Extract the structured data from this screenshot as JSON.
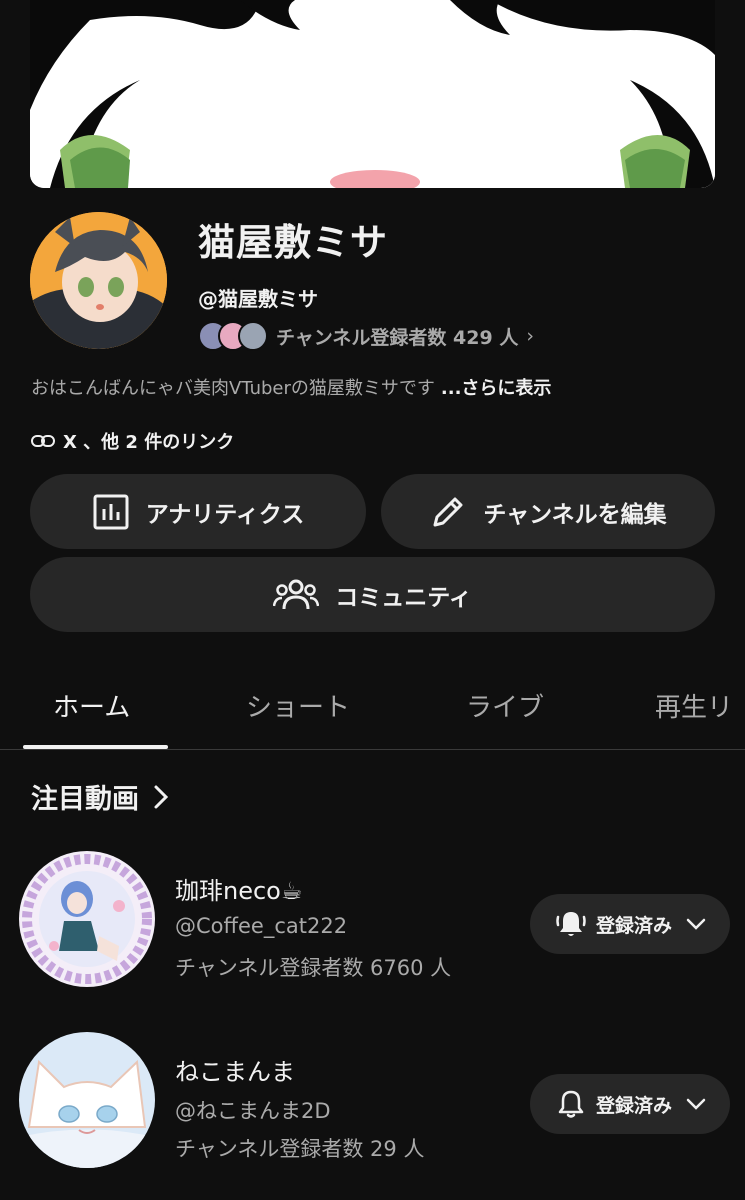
{
  "channel": {
    "name": "猫屋敷ミサ",
    "handle": "@猫屋敷ミサ",
    "subscribers": "チャンネル登録者数 429 人",
    "description": "おはこんばんにゃバ美肉VTuberの猫屋敷ミサです",
    "description_more": "...さらに表示",
    "links": "X 、他 2 件のリンク"
  },
  "buttons": {
    "analytics": "アナリティクス",
    "edit_channel": "チャンネルを編集",
    "community": "コミュニティ"
  },
  "tabs": [
    {
      "label": "ホーム",
      "active": true
    },
    {
      "label": "ショート",
      "active": false
    },
    {
      "label": "ライブ",
      "active": false
    },
    {
      "label": "再生リ",
      "active": false
    }
  ],
  "featured": {
    "title": "注目動画",
    "channels": [
      {
        "name": "珈琲neco☕",
        "handle": "@Coffee_cat222",
        "subscribers": "チャンネル登録者数 6760 人",
        "button_label": "登録済み",
        "bell": "bell-ringing-icon"
      },
      {
        "name": "ねこまんま",
        "handle": "@ねこまんま2D",
        "subscribers": "チャンネル登録者数 29 人",
        "button_label": "登録済み",
        "bell": "bell-outline-icon"
      }
    ]
  },
  "colors": {
    "background": "#0f0f0f",
    "button": "#272727",
    "text_secondary": "#aaaaaa",
    "text_primary": "#f1f1f1"
  }
}
